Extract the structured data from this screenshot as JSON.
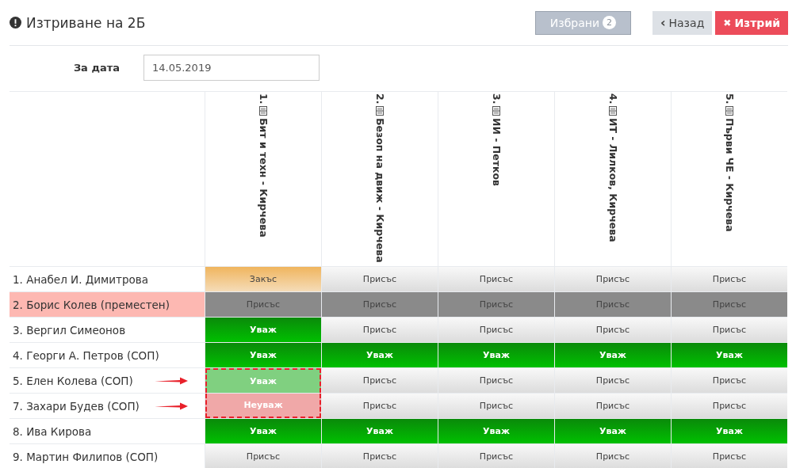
{
  "title": "Изтриване на 2Б",
  "selected_button": {
    "label": "Избрани",
    "count": "2"
  },
  "back_button": {
    "icon": "‹",
    "label": "Назад"
  },
  "delete_button": {
    "icon": "✖",
    "label": "Изтрий"
  },
  "date": {
    "label": "За дата",
    "value": "14.05.2019"
  },
  "columns": [
    {
      "number": "1.",
      "label": "Бит и техн - Кирчева"
    },
    {
      "number": "2.",
      "label": "Безоп на движ - Кирчева"
    },
    {
      "number": "3.",
      "label": "ИИ - Петков"
    },
    {
      "number": "4.",
      "label": "ИТ - Лилков, Кирчева"
    },
    {
      "number": "5.",
      "label": "Първи ЧЕ - Кирчева"
    }
  ],
  "rows": [
    {
      "name": "1. Анабел И. Димитрова",
      "moved": false,
      "arrow": false,
      "cells": [
        {
          "kind": "late",
          "text": "Закъс",
          "changed": false
        },
        {
          "kind": "present",
          "text": "Присъс",
          "changed": false
        },
        {
          "kind": "present",
          "text": "Присъс",
          "changed": false
        },
        {
          "kind": "present",
          "text": "Присъс",
          "changed": false
        },
        {
          "kind": "present",
          "text": "Присъс",
          "changed": false
        }
      ]
    },
    {
      "name": "2. Борис Колев (преместен)",
      "moved": true,
      "arrow": false,
      "cells": [
        {
          "kind": "present",
          "text": "Присъс",
          "changed": false
        },
        {
          "kind": "present",
          "text": "Присъс",
          "changed": false
        },
        {
          "kind": "present",
          "text": "Присъс",
          "changed": false
        },
        {
          "kind": "present",
          "text": "Присъс",
          "changed": false
        },
        {
          "kind": "present",
          "text": "Присъс",
          "changed": false
        }
      ]
    },
    {
      "name": "3. Вергил Симеонов",
      "moved": false,
      "arrow": false,
      "cells": [
        {
          "kind": "excused",
          "text": "Уваж",
          "changed": false
        },
        {
          "kind": "present",
          "text": "Присъс",
          "changed": false
        },
        {
          "kind": "present",
          "text": "Присъс",
          "changed": false
        },
        {
          "kind": "present",
          "text": "Присъс",
          "changed": false
        },
        {
          "kind": "present",
          "text": "Присъс",
          "changed": false
        }
      ]
    },
    {
      "name": "4. Георги А. Петров (СОП)",
      "moved": false,
      "arrow": false,
      "cells": [
        {
          "kind": "excused",
          "text": "Уваж",
          "changed": false
        },
        {
          "kind": "excused",
          "text": "Уваж",
          "changed": false
        },
        {
          "kind": "excused",
          "text": "Уваж",
          "changed": false
        },
        {
          "kind": "excused",
          "text": "Уваж",
          "changed": false
        },
        {
          "kind": "excused",
          "text": "Уваж",
          "changed": false
        }
      ]
    },
    {
      "name": "5. Елен Колева (СОП)",
      "moved": false,
      "arrow": true,
      "cells": [
        {
          "kind": "excused",
          "text": "Уваж",
          "changed": true
        },
        {
          "kind": "present",
          "text": "Присъс",
          "changed": false
        },
        {
          "kind": "present",
          "text": "Присъс",
          "changed": false
        },
        {
          "kind": "present",
          "text": "Присъс",
          "changed": false
        },
        {
          "kind": "present",
          "text": "Присъс",
          "changed": false
        }
      ]
    },
    {
      "name": "7. Захари Будев (СОП)",
      "moved": false,
      "arrow": true,
      "cells": [
        {
          "kind": "unexcused",
          "text": "Неуваж",
          "changed": true
        },
        {
          "kind": "present",
          "text": "Присъс",
          "changed": false
        },
        {
          "kind": "present",
          "text": "Присъс",
          "changed": false
        },
        {
          "kind": "present",
          "text": "Присъс",
          "changed": false
        },
        {
          "kind": "present",
          "text": "Присъс",
          "changed": false
        }
      ]
    },
    {
      "name": "8. Ива Кирова",
      "moved": false,
      "arrow": false,
      "cells": [
        {
          "kind": "excused",
          "text": "Уваж",
          "changed": false
        },
        {
          "kind": "excused",
          "text": "Уваж",
          "changed": false
        },
        {
          "kind": "excused",
          "text": "Уваж",
          "changed": false
        },
        {
          "kind": "excused",
          "text": "Уваж",
          "changed": false
        },
        {
          "kind": "excused",
          "text": "Уваж",
          "changed": false
        }
      ]
    },
    {
      "name": "9. Мартин Филипов (СОП)",
      "moved": false,
      "arrow": false,
      "cells": [
        {
          "kind": "present",
          "text": "Присъс",
          "changed": false
        },
        {
          "kind": "present",
          "text": "Присъс",
          "changed": false
        },
        {
          "kind": "present",
          "text": "Присъс",
          "changed": false
        },
        {
          "kind": "present",
          "text": "Присъс",
          "changed": false
        },
        {
          "kind": "present",
          "text": "Присъс",
          "changed": false
        }
      ]
    }
  ]
}
